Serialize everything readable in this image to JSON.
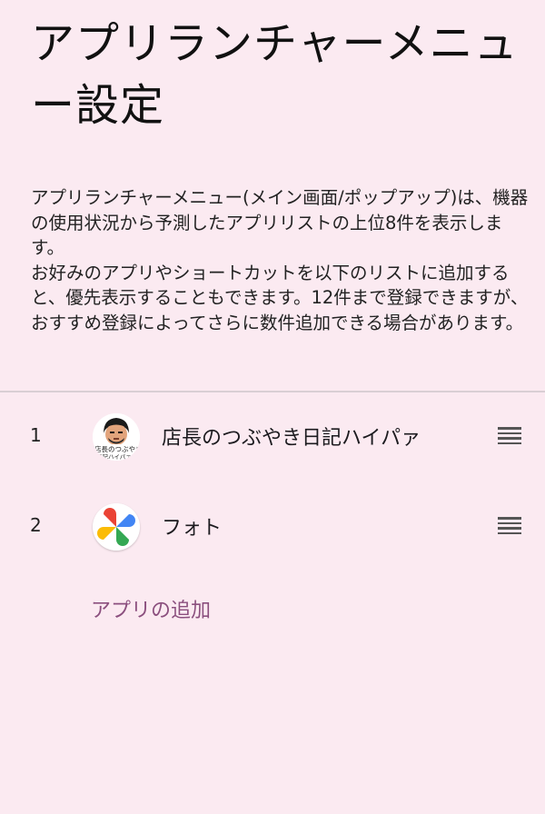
{
  "page": {
    "title": "アプリランチャーメニュー設定",
    "description": "アプリランチャーメニュー(メイン画面/ポップアップ)は、機器の使用状況から予測したアプリリストの上位8件を表示します。\nお好みのアプリやショートカットを以下のリストに追加すると、優先表示することもできます。12件まで登録できますが、おすすめ登録によってさらに数件追加できる場合があります。"
  },
  "apps": [
    {
      "index": "1",
      "name": "店長のつぶやき日記ハイパァ",
      "icon": "blog-avatar-icon",
      "icon_text_line1": "店長のつぶやき",
      "icon_text_line2": "日記ハイパァ3"
    },
    {
      "index": "2",
      "name": "フォト",
      "icon": "google-photos-icon"
    }
  ],
  "actions": {
    "add_app_label": "アプリの追加"
  },
  "colors": {
    "background": "#fbeaf1",
    "accent": "#8b4f7e",
    "divider": "#d9cfd4"
  }
}
